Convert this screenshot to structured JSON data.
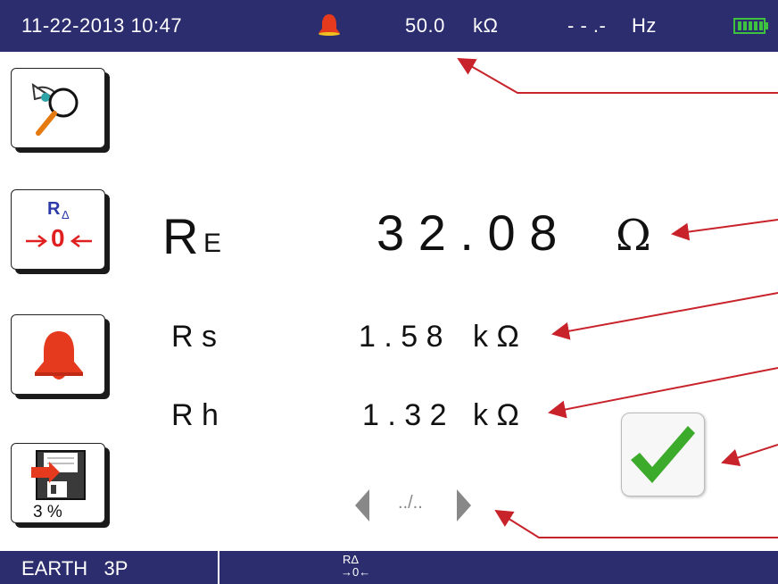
{
  "status_bar": {
    "datetime": "11-22-2013 10:47",
    "limit_value": "50.0",
    "limit_unit": "kΩ",
    "frequency_value": "- - .-",
    "frequency_unit": "Hz",
    "icons": [
      "alarm-bell-icon",
      "battery-full-icon"
    ],
    "colors": {
      "bar_bg": "#2b2d6e",
      "bell": "#e53a1d",
      "battery": "#3ec13e"
    }
  },
  "side_buttons": [
    {
      "name": "view-results-button",
      "icon": "eye-magnifier-icon"
    },
    {
      "name": "lead-compensation-button",
      "icon": "r-delta-zero-icon",
      "icon_text": "R",
      "icon_sub": "Δ",
      "icon_zero": "0"
    },
    {
      "name": "alarm-button",
      "icon": "alarm-bell-icon"
    },
    {
      "name": "save-button",
      "icon": "floppy-save-icon",
      "memory": "3 %"
    }
  ],
  "main": {
    "re_label": "R",
    "re_sub": "E",
    "re_value": "3 2 . 0 8",
    "re_unit": "Ω",
    "rs_label": "R s",
    "rs_value": "1 . 5 8",
    "rs_unit": "k Ω",
    "rh_label": "R h",
    "rh_value": "1 . 3 2",
    "rh_unit": "k Ω",
    "pager": "../..",
    "pass_icon": "checkmark-icon"
  },
  "bottom_bar": {
    "mode": "EARTH   3P",
    "comp_icon_top": "RΔ",
    "comp_icon_bottom": "→0←"
  },
  "annotation_color": "#c8222a"
}
